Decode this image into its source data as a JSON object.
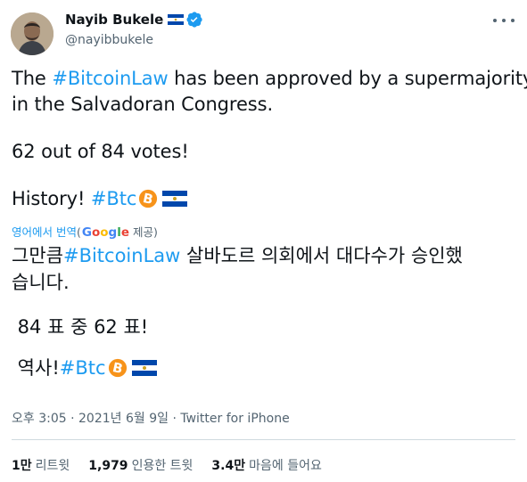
{
  "author": {
    "name": "Nayib Bukele",
    "handle": "@nayibbukele",
    "flag_icon": "el-salvador-flag-icon",
    "verified_icon": "verified-badge-icon"
  },
  "tweet": {
    "line1_pre": "The ",
    "line1_tag": "#BitcoinLaw",
    "line1_post": " has been approved by a supermajority",
    "line2": "in the Salvadoran Congress.",
    "line3": "62 out of 84 votes!",
    "line4_pre": "History! ",
    "line4_tag": "#Btc"
  },
  "translation": {
    "label": "영어에서 번역",
    "provider_open": "(",
    "provider_g1": "G",
    "provider_o1": "o",
    "provider_o2": "o",
    "provider_g2": "g",
    "provider_l": "l",
    "provider_e": "e",
    "provider_suffix": " 제공)",
    "line1_pre": "그만큼",
    "line1_tag": "#BitcoinLaw",
    "line1_post": " 살바도르 의회에서 대다수가 승인했",
    "line2": "습니다.",
    "line3": " 84 표 중 62 표!",
    "line4_pre": " 역사!",
    "line4_tag": "#Btc"
  },
  "meta": {
    "time": "오후 3:05",
    "date": "2021년 6월 9일",
    "separator": " · ",
    "source": "Twitter for iPhone"
  },
  "stats": {
    "retweets_count": "1만",
    "retweets_label": "리트윗",
    "quotes_count": "1,979",
    "quotes_label": "인용한 트윗",
    "likes_count": "3.4만",
    "likes_label": "마음에 들어요"
  },
  "colors": {
    "link": "#1d9bf0",
    "text": "#0f1419",
    "secondary": "#536471",
    "bitcoin": "#f7931a"
  }
}
